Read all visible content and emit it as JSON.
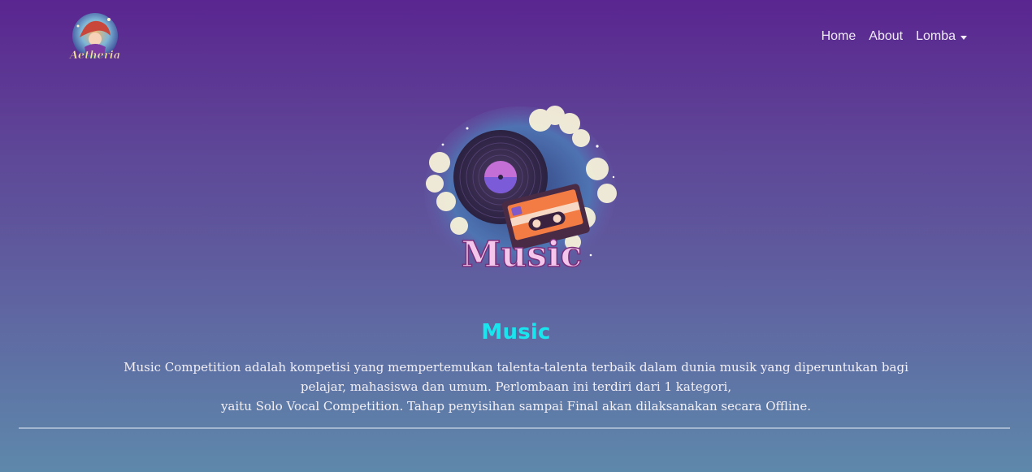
{
  "navbar": {
    "logo_text": "Aetheria",
    "links": [
      {
        "label": "Home"
      },
      {
        "label": "About"
      },
      {
        "label": "Lomba"
      }
    ]
  },
  "hero": {
    "emblem_text": "Music",
    "title": "Music",
    "description_lines": [
      "Music Competition adalah kompetisi yang mempertemukan talenta-talenta terbaik dalam dunia musik yang diperuntukan bagi",
      "pelajar, mahasiswa dan umum. Perlombaan ini terdiri dari 1 kategori,",
      "yaitu Solo Vocal Competition. Tahap penyisihan sampai Final akan dilaksanakan secara Offline."
    ]
  },
  "colors": {
    "title": "#19e5ef",
    "background_top": "#5a2590",
    "background_bottom": "#5e88ab"
  }
}
